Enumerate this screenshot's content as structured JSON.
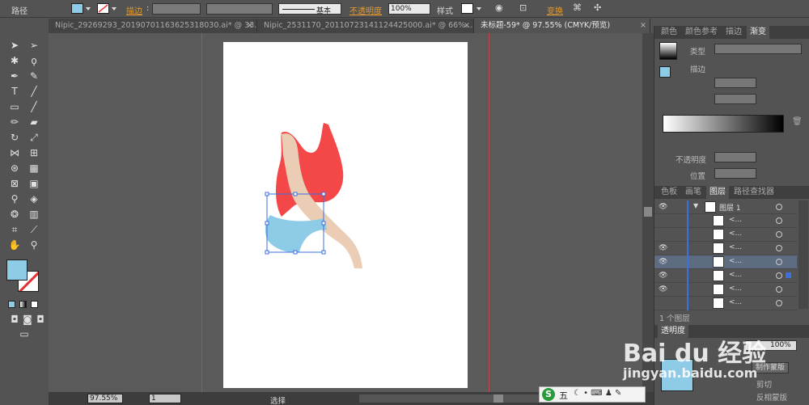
{
  "control_bar": {
    "object_type": "路径",
    "fill_color": "#8ecbe6",
    "stroke_label": "描边",
    "brush_label": "基本",
    "opacity_label": "不透明度",
    "opacity_value": "100%",
    "style_label": "样式",
    "transform_label": "变换"
  },
  "tabs": [
    {
      "label": "Nipic_29269293_20190701163625318030.ai* @ 33...",
      "active": false
    },
    {
      "label": "Nipic_2531170_20110723141124425000.ai* @ 66%...",
      "active": false
    },
    {
      "label": "未标题-59* @ 97.55% (CMYK/预览)",
      "active": true
    }
  ],
  "panel_color": {
    "tabs": [
      "颜色",
      "颜色参考",
      "描边",
      "渐变"
    ],
    "type_label": "类型",
    "stroke_label": "描边",
    "opacity_label": "不透明度",
    "position_label": "位置"
  },
  "panel_layers": {
    "tabs": [
      "色板",
      "画笔",
      "图层",
      "路径查找器"
    ],
    "layer_name": "图层 1",
    "sublayer_label": "<...",
    "count_label": "1 个图层"
  },
  "panel_transparency": {
    "tab": "透明度",
    "opacity_value": "100%",
    "make_mask_label": "制作蒙版",
    "clip_label": "剪切",
    "invert_label": "反相蒙版"
  },
  "status": {
    "zoom": "97.55%",
    "page": "1",
    "tool_label": "选择"
  },
  "watermark": {
    "logo": "Bai du 经验",
    "url": "jingyan.baidu.com"
  },
  "ime": {
    "label": "五"
  },
  "colors": {
    "shirt": "#f44747",
    "shorts": "#8ecbe6",
    "skin": "#ebccb4",
    "guide": "#c0474a",
    "selection": "#3e6fe0"
  }
}
